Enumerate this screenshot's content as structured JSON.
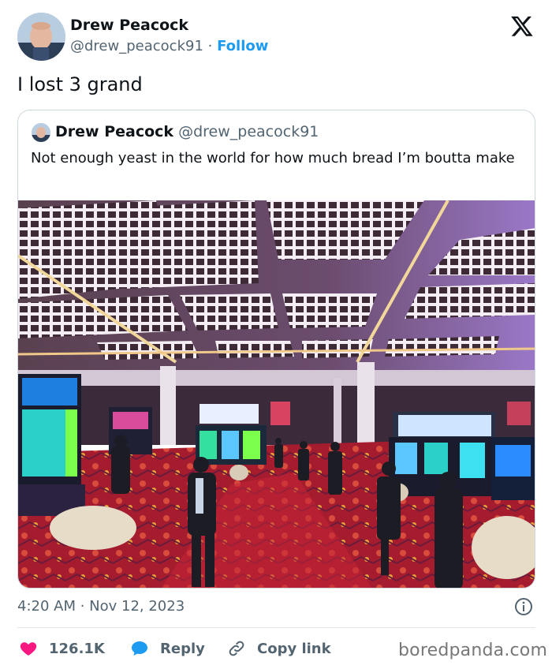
{
  "tweet": {
    "author_name": "Drew Peacock",
    "author_handle": "@drew_peacock91",
    "separator": "·",
    "follow_label": "Follow",
    "text": "I lost 3 grand",
    "timestamp": "4:20 AM · Nov 12, 2023"
  },
  "quoted_tweet": {
    "author_name": "Drew Peacock",
    "author_handle": "@drew_peacock91",
    "text": "Not enough yeast in the world for how much bread I’m boutta make",
    "image_subject": "casino-floor-photo"
  },
  "actions": {
    "like_count": "126.1K",
    "reply_label": "Reply",
    "copy_link_label": "Copy link"
  },
  "watermark": "boredpanda.com",
  "icons": {
    "logo": "x-logo-icon",
    "info": "info-icon",
    "like": "heart-icon",
    "reply": "reply-bubble-icon",
    "copy": "link-icon"
  },
  "colors": {
    "text_primary": "#0f1419",
    "text_secondary": "#536471",
    "accent_blue": "#1d9bf0",
    "like_red": "#f91880",
    "border": "#cfd9de"
  }
}
